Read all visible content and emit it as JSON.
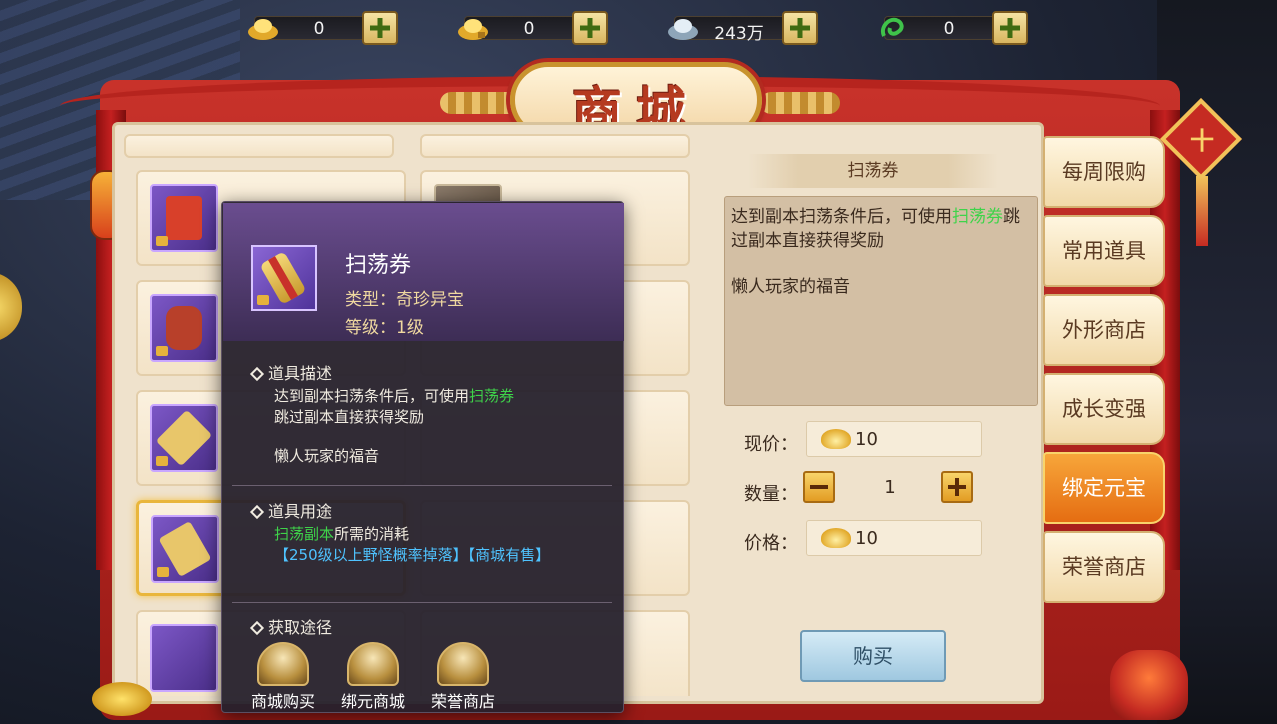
{
  "currencies": [
    {
      "icon": "gold-ingot-icon",
      "value": "0"
    },
    {
      "icon": "bound-gold-ingot-icon",
      "value": "0"
    },
    {
      "icon": "silver-ingot-icon",
      "value": "243万"
    },
    {
      "icon": "jade-dragon-icon",
      "value": "0"
    }
  ],
  "shop": {
    "title": "商城"
  },
  "grid_items": [
    {
      "name": "",
      "price": ""
    },
    {
      "name": "",
      "price": ""
    },
    {
      "name": "",
      "price": ""
    },
    {
      "name": "",
      "price": ""
    }
  ],
  "tooltip": {
    "name": "扫荡券",
    "type_label": "类型：奇珍异宝",
    "level_label": "等级：1级",
    "desc_heading": "道具描述",
    "desc_line1_prefix": "达到副本扫荡条件后，可使用",
    "desc_line1_highlight": "扫荡券",
    "desc_line2": "跳过副本直接获得奖励",
    "flavor": "懒人玩家的福音",
    "usage_heading": "道具用途",
    "usage_highlight": "扫荡副本",
    "usage_suffix": "所需的消耗",
    "usage_sources": "【250级以上野怪概率掉落】【商城有售】",
    "obtain_heading": "获取途径",
    "sources": [
      {
        "label": "商城购买"
      },
      {
        "label": "绑元商城"
      },
      {
        "label": "荣誉商店"
      }
    ]
  },
  "detail": {
    "title": "扫荡券",
    "desc_prefix": "达到副本扫荡条件后，可使用",
    "desc_highlight": "扫荡券",
    "desc_suffix": "跳过副本直接获得奖励",
    "flavor": "懒人玩家的福音",
    "current_price_label": "现价：",
    "current_price": "10",
    "quantity_label": "数量：",
    "quantity": "1",
    "total_label": "价格：",
    "total_price": "10",
    "buy_label": "购买"
  },
  "tabs": [
    {
      "label": "每周限购",
      "active": false
    },
    {
      "label": "常用道具",
      "active": false
    },
    {
      "label": "外形商店",
      "active": false
    },
    {
      "label": "成长变强",
      "active": false
    },
    {
      "label": "绑定元宝",
      "active": true
    },
    {
      "label": "荣誉商店",
      "active": false
    }
  ],
  "decor": {
    "charm_glyph": "十"
  },
  "colors": {
    "frame_red": "#b6241e",
    "paper": "#efe2cc",
    "tab_active": "#e56d12",
    "highlight_green": "#3fd34a",
    "highlight_blue": "#4fc3ff"
  }
}
